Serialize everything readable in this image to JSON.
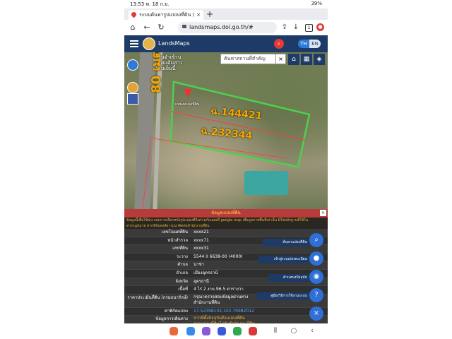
{
  "status": {
    "left": "13:53 พ. 18 ก.ย.",
    "right": "39%"
  },
  "tab": {
    "title": "ระบบค้นหารูปแปลงที่ดิน (Land",
    "close": "×",
    "new": "+"
  },
  "browser": {
    "url": "landsmaps.dol.go.th/#",
    "tab_count": "1"
  },
  "app": {
    "title": "LandsMaps",
    "lang_th": "TH",
    "lang_en": "EN"
  },
  "map": {
    "search_placeholder": "ค้นหาสถานที่สำคัญ",
    "search_close": "×",
    "place_label_1": "ร้านจำเข้าน",
    "place_label_2": "แต่งแต้มสาว",
    "place_label_3": "ร้านเย็นนี้",
    "parcel_1": "ฉ.144421",
    "parcel_2": "ฉ.232344",
    "meters": "80 เมตร",
    "pin_label": "แหน่งแปลงที่ดิน",
    "colors": {
      "parcel_outline": "#4cd24c",
      "parcel_line": "#ff3b3b"
    }
  },
  "info": {
    "header": "ข้อมูลแปลงที่ดิน",
    "close": "×",
    "notice_1": "ข้อมูลนี้เพื่อใช้ประกอบการเลือกหนังรูปแปลงที่ดินร่วมกับแผนที่ google map เพื่อดูสภาพพื้นที่เท่านั้น มิใช่หลักฐานที่ใช้ใน",
    "notice_2": "ทางกฎหมาย หากมีข้อสงสัย กรุณาติดต่อสำนักงานที่ดิน",
    "rows": [
      {
        "k": "เลขโฉนดที่ดิน",
        "v": "xxxx21"
      },
      {
        "k": "หน้าสำรวจ",
        "v": "xxxx71"
      },
      {
        "k": "เลขที่ดิน",
        "v": "xxxx31"
      },
      {
        "k": "ระวาง",
        "v": "5544 II 6638-00 (4000)"
      },
      {
        "k": "ตำบล",
        "v": "นาข่า"
      },
      {
        "k": "อำเภอ",
        "v": "เมืองอุดรธานี"
      },
      {
        "k": "จังหวัด",
        "v": "อุดรธานี"
      },
      {
        "k": "เนื้อที่",
        "v": "4 ไร่ 2 งาน 96.5 ตารางวา"
      }
    ],
    "appraisal_k": "ราคาประเมินที่ดิน (กรมธนารักษ์)",
    "appraisal_v1": "กรุณาตรวจสอบข้อมูลผ่านทาง",
    "appraisal_v2": "สำนักงานที่ดิน",
    "coord_k": "ค่าพิกัดแปลง",
    "coord_v": "17.52398102,102.79982012",
    "manage_k": "ข้อมูลการเดินทาง",
    "manage_v1": "จากที่ตั้งปัจจุบันถึงแปลงที่ดิน",
    "manage_v2": "จากแปลงที่ดินไปยังสำนักงานที่ดิน"
  },
  "fabs": {
    "search": "ค้นหาแปลงที่ดิน",
    "register": "เข้าสู่ระบบ/ลงทะเบียน",
    "location": "ตำแหน่งปัจจุบัน",
    "help": "คู่มือ/วิธีการใช้งานระบบ",
    "search_icon": "⌕",
    "user_icon": "●",
    "locate_icon": "◉",
    "help_icon": "?",
    "close_icon": "×"
  }
}
